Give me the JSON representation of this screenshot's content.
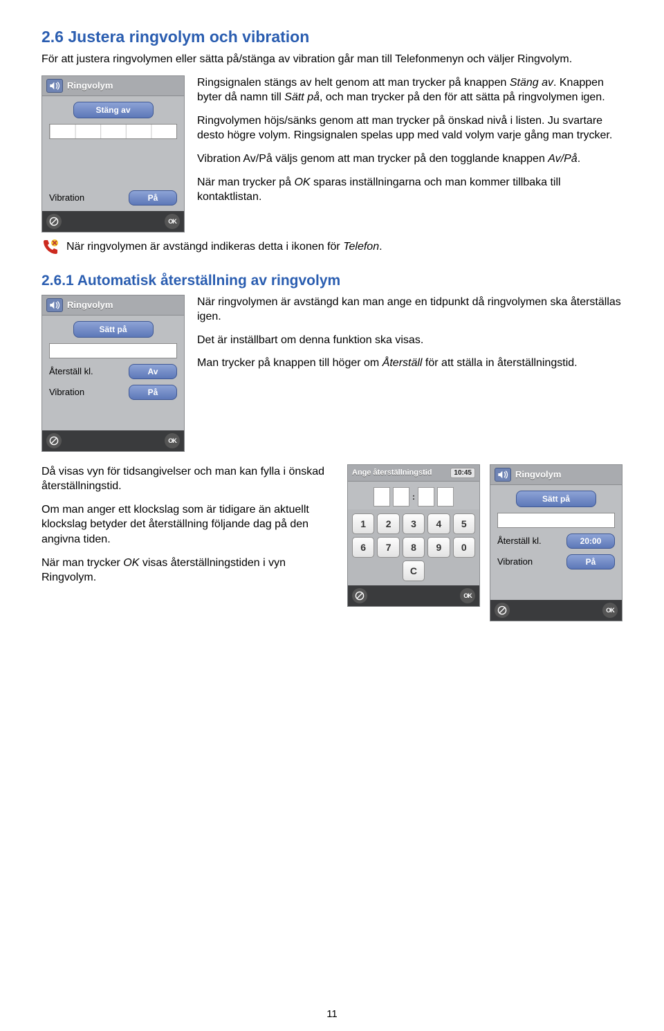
{
  "sec26": {
    "heading": "2.6 Justera ringvolym och vibration",
    "intro": "För att justera ringvolymen eller sätta på/stänga av vibration går man till Telefonmenyn och väljer Ringvolym.",
    "p1a": "Ringsignalen stängs av helt genom att man trycker på knappen ",
    "p1i": "Stäng av",
    "p1b": ". Knappen byter då namn till ",
    "p1i2": "Sätt på",
    "p1c": ", och man trycker på den för att sätta på ringvolymen igen.",
    "p2": "Ringvolymen höjs/sänks genom att man trycker på önskad nivå i listen. Ju svartare desto högre volym. Ringsignalen spelas upp med vald volym varje gång man trycker.",
    "p3a": "Vibration Av/På väljs genom att man trycker på den togglande knappen ",
    "p3i": "Av/På",
    "p3b": ".",
    "p4a": "När man trycker på ",
    "p4i": "OK",
    "p4b": " sparas inställningarna och man kommer tillbaka till kontaktlistan.",
    "mutedLine": "När ringvolymen är avstängd indikeras detta i ikonen för ",
    "mutedLineI": "Telefon",
    "mutedLineEnd": "."
  },
  "shotA": {
    "title": "Ringvolym",
    "btn": "Stäng av",
    "vibLabel": "Vibration",
    "vibVal": "På",
    "ok": "OK"
  },
  "sec261": {
    "heading": "2.6.1 Automatisk återställning av ringvolym",
    "p1": "När ringvolymen är avstängd kan man ange en tidpunkt då ringvolymen ska återställas igen.",
    "p2": "Det är inställbart om denna funktion ska visas.",
    "p3a": "Man trycker på knappen till höger om ",
    "p3i": "Återställ",
    "p3b": " för att ställa in återställningstid."
  },
  "shotB": {
    "title": "Ringvolym",
    "btn": "Sätt på",
    "resetLabel": "Återställ kl.",
    "resetVal": "Av",
    "vibLabel": "Vibration",
    "vibVal": "På",
    "ok": "OK"
  },
  "bottom": {
    "p1": "Då visas vyn för tidsangivelser och man kan fylla i önskad återställningstid.",
    "p2": "Om man anger ett klockslag som är tidigare än aktuellt klockslag betyder det återställning följande dag på den angivna tiden.",
    "p3a": "När man trycker ",
    "p3i": "OK",
    "p3b": " visas återställnings­tiden i vyn Ringvolym."
  },
  "shotC": {
    "title": "Ange återställningstid",
    "clock": "10:45",
    "keys": [
      "1",
      "2",
      "3",
      "4",
      "5",
      "6",
      "7",
      "8",
      "9",
      "0"
    ],
    "keyC": "C",
    "ok": "OK"
  },
  "shotD": {
    "title": "Ringvolym",
    "btn": "Sätt på",
    "resetLabel": "Återställ kl.",
    "resetVal": "20:00",
    "vibLabel": "Vibration",
    "vibVal": "På",
    "ok": "OK"
  },
  "pageNumber": "11"
}
